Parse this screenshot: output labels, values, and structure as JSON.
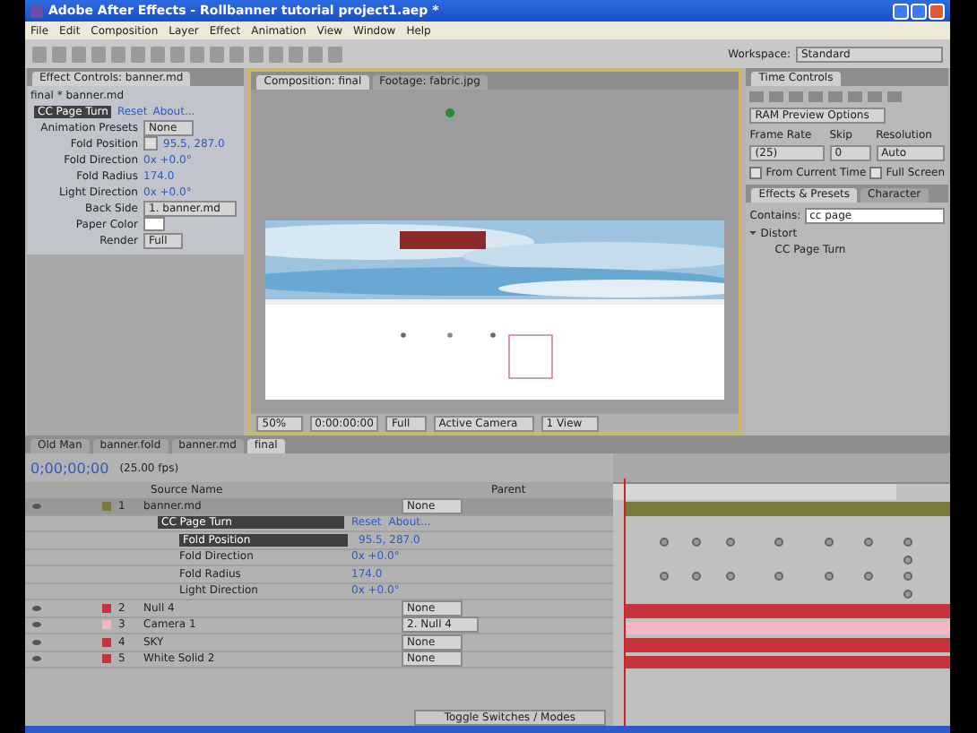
{
  "window": {
    "title": "Adobe After Effects - Rollbanner tutorial project1.aep *"
  },
  "menu": [
    "File",
    "Edit",
    "Composition",
    "Layer",
    "Effect",
    "Animation",
    "View",
    "Window",
    "Help"
  ],
  "workspace": {
    "label": "Workspace:",
    "value": "Standard"
  },
  "effect_controls": {
    "tab": "Effect Controls: banner.md",
    "subtitle": "final * banner.md",
    "effect": {
      "name": "CC Page Turn",
      "reset": "Reset",
      "about": "About..."
    },
    "rows": [
      {
        "kind": "dropdown",
        "label": "Animation Presets",
        "value": "None"
      },
      {
        "kind": "point",
        "label": "Fold Position",
        "value": "95.5, 287.0"
      },
      {
        "kind": "value",
        "label": "Fold Direction",
        "value": "0x +0.0°"
      },
      {
        "kind": "value",
        "label": "Fold Radius",
        "value": "174.0"
      },
      {
        "kind": "value",
        "label": "Light Direction",
        "value": "0x +0.0°"
      },
      {
        "kind": "dropdown",
        "label": "Back Side",
        "value": "1. banner.md"
      },
      {
        "kind": "color",
        "label": "Paper Color"
      },
      {
        "kind": "dropdown",
        "label": "Render",
        "value": "Full"
      }
    ]
  },
  "viewer": {
    "tabs": [
      {
        "label": "Composition: final",
        "selected": true
      },
      {
        "label": "Footage: fabric.jpg",
        "selected": false
      }
    ],
    "toolbar": {
      "zoom": "50%",
      "time": "0:00:00:00",
      "resolution": "Full",
      "camera": "Active Camera",
      "views": "1 View"
    }
  },
  "time_controls": {
    "tab": "Time Controls",
    "preview": "RAM Preview Options",
    "frame_rate_label": "Frame Rate",
    "skip_label": "Skip",
    "resolution_label": "Resolution",
    "frame_rate": "(25)",
    "skip": "0",
    "resolution": "Auto",
    "from_current": {
      "label": "From Current Time",
      "checked": false
    },
    "full_screen": {
      "label": "Full Screen",
      "checked": false
    }
  },
  "effects_presets": {
    "tabs": [
      {
        "label": "Effects & Presets",
        "selected": true
      },
      {
        "label": "Character",
        "selected": false
      }
    ],
    "contains_label": "Contains:",
    "search": "cc page",
    "tree": [
      {
        "name": "Distort",
        "expanded": true,
        "children": [
          {
            "name": "CC Page Turn"
          }
        ]
      }
    ]
  },
  "timeline": {
    "tabs": [
      {
        "label": "Old Man",
        "selected": false
      },
      {
        "label": "banner.fold",
        "selected": false
      },
      {
        "label": "banner.md",
        "selected": false
      },
      {
        "label": "final",
        "selected": true
      }
    ],
    "time": "0;00;00;00",
    "fps": "(25.00 fps)",
    "columns": [
      "Source Name",
      "Parent"
    ],
    "layers": [
      {
        "num": "1",
        "name": "banner.md",
        "color": "#7a7a3a",
        "selected": true,
        "parent": "None",
        "effect": {
          "name": "CC Page Turn",
          "reset": "Reset",
          "about": "About...",
          "properties": [
            {
              "name": "Fold Position",
              "value": "95.5, 287.0",
              "selected": true
            },
            {
              "name": "Fold Direction",
              "value": "0x +0.0°",
              "selected": false
            },
            {
              "name": "Fold Radius",
              "value": "174.0",
              "selected": false
            },
            {
              "name": "Light Direction",
              "value": "0x +0.0°",
              "selected": false
            }
          ]
        }
      },
      {
        "num": "2",
        "name": "Null 4",
        "color": "#c8343c",
        "selected": false,
        "parent": "None"
      },
      {
        "num": "3",
        "name": "Camera 1",
        "color": "#f2b8c2",
        "selected": false,
        "parent": "2. Null 4"
      },
      {
        "num": "4",
        "name": "SKY",
        "color": "#c8343c",
        "selected": false,
        "parent": "None"
      },
      {
        "num": "5",
        "name": "White Solid 2",
        "color": "#c8343c",
        "selected": false,
        "parent": "None"
      }
    ],
    "toggle": "Toggle Switches / Modes"
  }
}
